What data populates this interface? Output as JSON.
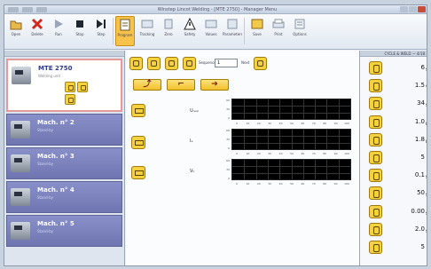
{
  "window": {
    "title": "Winstep Lincot Welding - [MTE 2750] - Manager Menu"
  },
  "ribbon": {
    "buttons": [
      {
        "label": "Open",
        "icon": "folder-icon"
      },
      {
        "label": "Delete",
        "icon": "close-icon"
      },
      {
        "label": "Run",
        "icon": "play-icon"
      },
      {
        "label": "Stop",
        "icon": "stop-icon"
      },
      {
        "label": "Step",
        "icon": "step-icon"
      },
      {
        "label": "Program",
        "icon": "program-icon"
      },
      {
        "label": "Tracking",
        "icon": "tracking-icon"
      },
      {
        "label": "Zero",
        "icon": "zero-icon"
      },
      {
        "label": "Safety",
        "icon": "warning-icon"
      },
      {
        "label": "Values",
        "icon": "values-icon"
      },
      {
        "label": "Parameters",
        "icon": "parameters-icon"
      },
      {
        "label": "Save",
        "icon": "save-icon"
      },
      {
        "label": "Print",
        "icon": "print-icon"
      },
      {
        "label": "Options",
        "icon": "options-icon"
      }
    ]
  },
  "machines": [
    {
      "name": "MTE 2750",
      "sub": "Welding unit"
    },
    {
      "name": "Mach. n° 2",
      "sub": "Stand-by"
    },
    {
      "name": "Mach. n° 3",
      "sub": "Stand-by"
    },
    {
      "name": "Mach. n° 4",
      "sub": "Stand-by"
    },
    {
      "name": "Mach. n° 5",
      "sub": "Stand-by"
    }
  ],
  "toolbar": {
    "field_label": "Sequence",
    "field_value": "1",
    "field2_label": "Next"
  },
  "plots": [
    {
      "label": "Uᵣₑₐₗ",
      "ymax": "60",
      "ymid": "30",
      "ymin": "0"
    },
    {
      "label": "Iₐ",
      "ymax": "60",
      "ymid": "30",
      "ymin": "0"
    },
    {
      "label": "Vₕ",
      "ymax": "60",
      "ymid": "30",
      "ymin": "0"
    }
  ],
  "x_ticks": [
    "0",
    "10",
    "20",
    "30",
    "40",
    "50",
    "60",
    "70",
    "80",
    "90",
    "100"
  ],
  "params_header": "CYCLE & WELD — 4/18",
  "params": [
    {
      "value": "6",
      "unit": "s"
    },
    {
      "value": "1.5",
      "unit": "%"
    },
    {
      "value": "34",
      "unit": "s"
    },
    {
      "value": "1.0",
      "unit": "m"
    },
    {
      "value": "1.8",
      "unit": "m"
    },
    {
      "value": "5",
      "unit": ""
    },
    {
      "value": "0.1",
      "unit": "s"
    },
    {
      "value": "50",
      "unit": "s"
    },
    {
      "value": "0.00",
      "unit": "s"
    },
    {
      "value": "2.0",
      "unit": "s"
    },
    {
      "value": "5",
      "unit": ""
    }
  ],
  "colors": {
    "accent": "#f6d13f",
    "machine_card": "#7c83bf",
    "plot_bg": "#000000"
  }
}
